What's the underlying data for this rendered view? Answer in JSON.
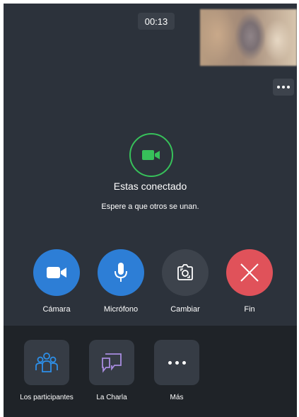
{
  "call": {
    "timer": "00:13",
    "status_title": "Estas conectado",
    "status_subtitle": "Espere a que otros se unan."
  },
  "controls": {
    "camera": "Cámara",
    "microphone": "Micrófono",
    "switch": "Cambiar",
    "end": "Fin"
  },
  "bottom_bar": {
    "participants": "Los participantes",
    "chat": "La Charla",
    "more": "Más"
  },
  "colors": {
    "background": "#2c323b",
    "bottom_bar": "#1f2328",
    "accent_blue": "#2d7ed6",
    "end_red": "#e0525a",
    "connected_green": "#37c15a"
  },
  "icons": [
    "camera-icon",
    "microphone-icon",
    "switch-camera-icon",
    "close-icon",
    "participants-icon",
    "chat-icon",
    "more-icon"
  ]
}
